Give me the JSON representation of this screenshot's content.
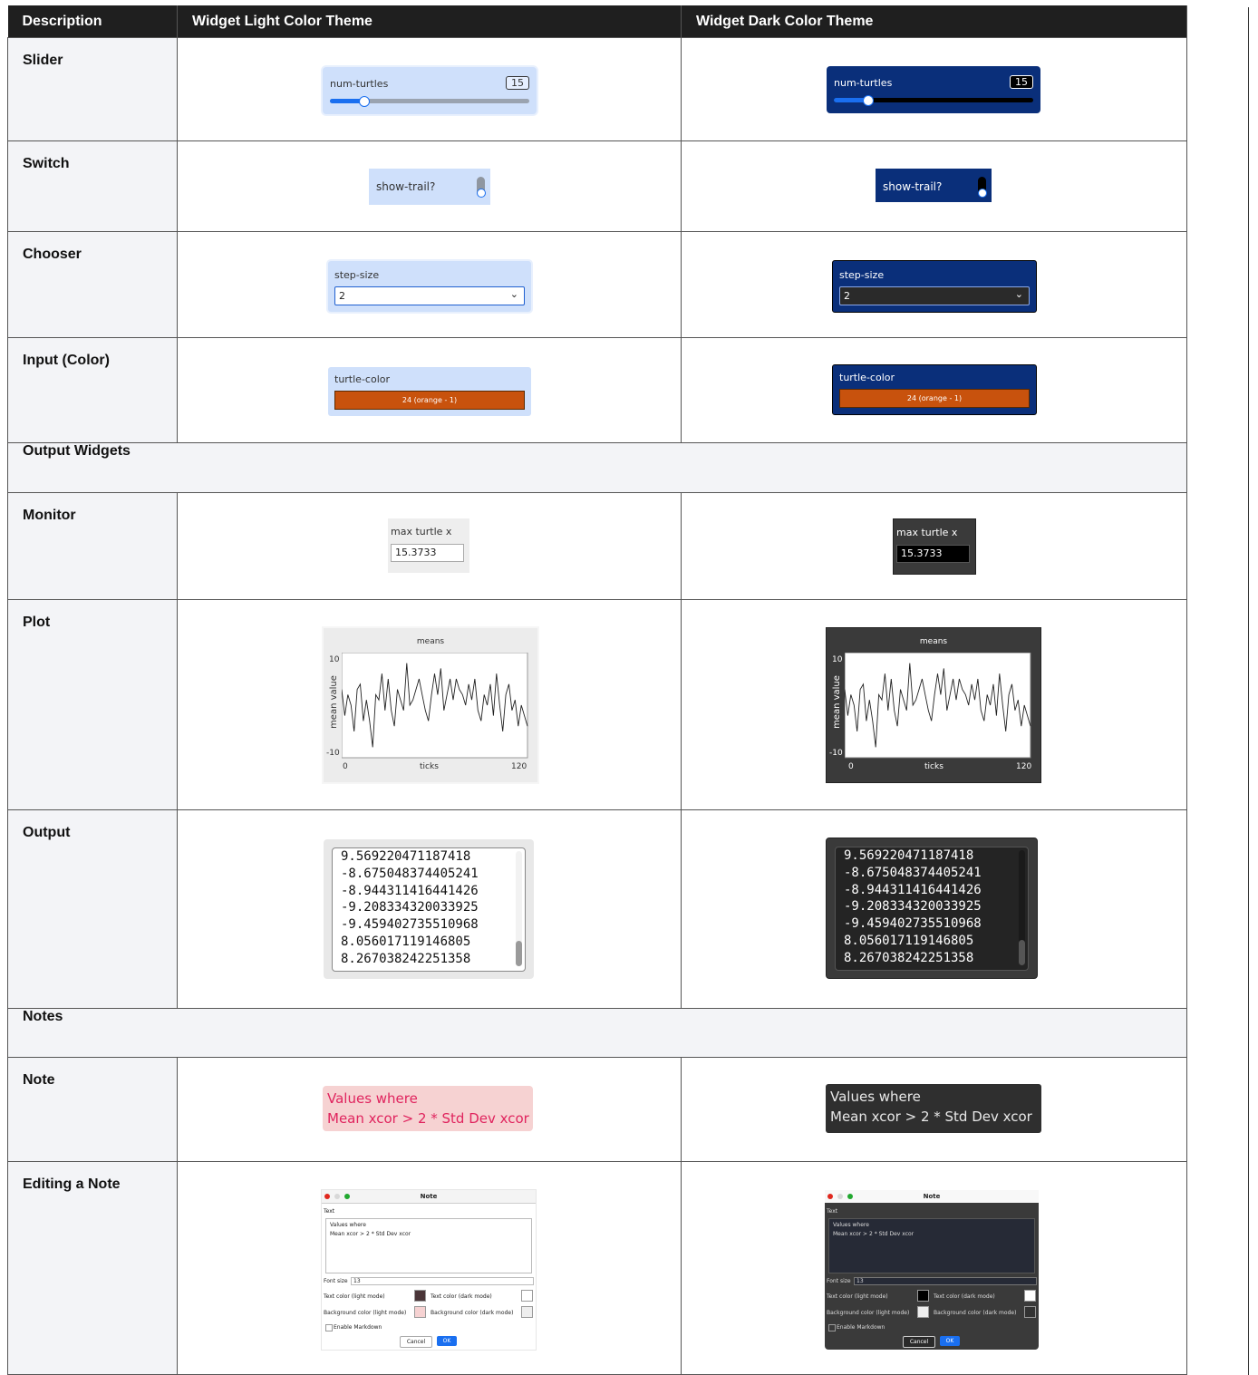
{
  "headers": [
    "Description",
    "Widget Light Color Theme",
    "Widget Dark Color Theme"
  ],
  "rows": {
    "slider": "Slider",
    "switch": "Switch",
    "chooser": "Chooser",
    "input": "Input (Color)",
    "output_section": "Output Widgets",
    "monitor": "Monitor",
    "plot": "Plot",
    "output": "Output",
    "notes_section": "Notes",
    "note": "Note",
    "edit_note": "Editing a Note"
  },
  "slider": {
    "label": "num-turtles",
    "value": "15",
    "level": 0.17
  },
  "switch": {
    "label": "show-trail?"
  },
  "chooser": {
    "label": "step-size",
    "value": "2"
  },
  "input": {
    "label": "turtle-color",
    "value": "24 (orange - 1)",
    "color": "#c8520d"
  },
  "monitor": {
    "label": "max turtle x",
    "value": "15.3733"
  },
  "plot": {
    "title": "means",
    "ylabel": "mean value",
    "xlabel": "ticks",
    "ymax": "10",
    "ymin": "-10",
    "xmin": "0",
    "xmax": "120"
  },
  "chart_data": {
    "type": "line",
    "title": "means",
    "xlabel": "ticks",
    "ylabel": "mean value",
    "xlim": [
      0,
      120
    ],
    "ylim": [
      -10,
      10
    ],
    "x": [
      0,
      2,
      4,
      6,
      8,
      10,
      12,
      14,
      16,
      18,
      20,
      22,
      24,
      26,
      28,
      30,
      32,
      34,
      36,
      38,
      40,
      42,
      44,
      46,
      48,
      50,
      52,
      54,
      56,
      58,
      60,
      62,
      64,
      66,
      68,
      70,
      72,
      74,
      76,
      78,
      80,
      82,
      84,
      86,
      88,
      90,
      92,
      94,
      96,
      98,
      100,
      102,
      104,
      106,
      108,
      110,
      112,
      114,
      116,
      118,
      120
    ],
    "y": [
      3,
      -2,
      2,
      0,
      -5,
      3,
      4,
      -3,
      1,
      -3,
      -8,
      2,
      1,
      6,
      -1,
      5,
      -1,
      -4,
      3,
      1,
      -1,
      8,
      0,
      1,
      3,
      5,
      2,
      -1,
      -3,
      2,
      6,
      2,
      7,
      -1,
      2,
      5,
      1,
      5,
      3,
      2,
      0,
      4,
      1,
      5,
      -1,
      -3,
      2,
      0,
      4,
      -2,
      6,
      0,
      -5,
      2,
      4,
      -1,
      1,
      -4,
      0,
      -2,
      -4
    ]
  },
  "output": {
    "lines": [
      "9.569220471187418",
      "-8.675048374405241",
      "-8.944311416441426",
      "-9.208334320033925",
      "-9.459402735510968",
      "8.056017119146805",
      "8.267038242251358"
    ]
  },
  "note": {
    "line1": "Values where",
    "line2": "Mean xcor > 2 * Std Dev xcor"
  },
  "editor": {
    "title": "Note",
    "text_label": "Text",
    "text_line1": "Values where",
    "text_line2": "Mean xcor > 2 * Std Dev xcor",
    "font_size_label": "Font size",
    "font_size": "13",
    "text_color_light": "Text color (light mode)",
    "text_color_dark": "Text color (dark mode)",
    "bg_color_light": "Background color (light mode)",
    "bg_color_dark": "Background color (dark mode)",
    "enable_markdown": "Enable Markdown",
    "cancel": "Cancel",
    "ok": "OK"
  },
  "colors": {
    "header_bg": "#1f1f1f",
    "widget_light": "#cfe0fb",
    "widget_dark": "#0a2f7a",
    "accent": "#1a6ff0",
    "note_pink": "#e0245e"
  }
}
